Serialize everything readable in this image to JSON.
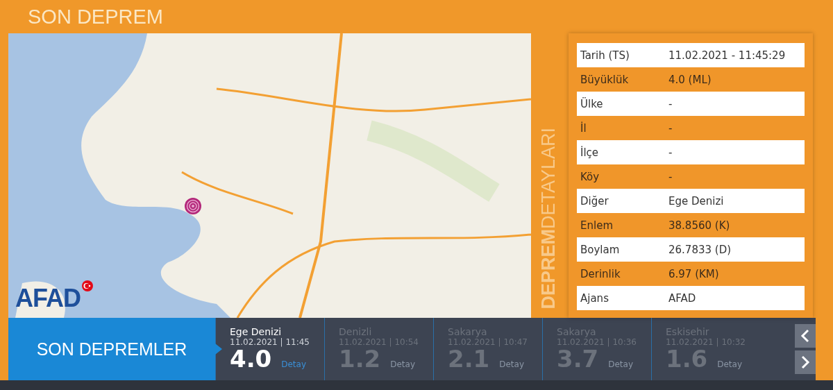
{
  "header": {
    "title": "SON DEPREM"
  },
  "map": {
    "logo": "AFAD"
  },
  "details": {
    "side_label": "**DEPREM**DETAYLARI",
    "rows": [
      {
        "label": "Tarih (TS)",
        "value": "11.02.2021 - 11:45:29"
      },
      {
        "label": "Büyüklük",
        "value": "4.0 (ML)"
      },
      {
        "label": "Ülke",
        "value": "-"
      },
      {
        "label": "İl",
        "value": "-"
      },
      {
        "label": "İlçe",
        "value": "-"
      },
      {
        "label": "Köy",
        "value": "-"
      },
      {
        "label": "Diğer",
        "value": "Ege Denizi"
      },
      {
        "label": "Enlem",
        "value": "38.8560 (K)"
      },
      {
        "label": "Boylam",
        "value": "26.7833 (D)"
      },
      {
        "label": "Derinlik",
        "value": "6.97 (KM)"
      },
      {
        "label": "Ajans",
        "value": "AFAD"
      }
    ]
  },
  "recent": {
    "title": "SON DEPREMLER",
    "items": [
      {
        "place": "Ege Denizi",
        "time": "11.02.2021 | 11:45",
        "magnitude": "4.0",
        "link": "Detay",
        "selected": true
      },
      {
        "place": "Denizli",
        "time": "11.02.2021 | 10:54",
        "magnitude": "1.2",
        "link": "Detay",
        "selected": false
      },
      {
        "place": "Sakarya",
        "time": "11.02.2021 | 10:47",
        "magnitude": "2.1",
        "link": "Detay",
        "selected": false
      },
      {
        "place": "Sakarya",
        "time": "11.02.2021 | 10:36",
        "magnitude": "3.7",
        "link": "Detay",
        "selected": false
      },
      {
        "place": "Eskisehir",
        "time": "11.02.2021 | 10:32",
        "magnitude": "1.6",
        "link": "Detay",
        "selected": false
      }
    ]
  }
}
